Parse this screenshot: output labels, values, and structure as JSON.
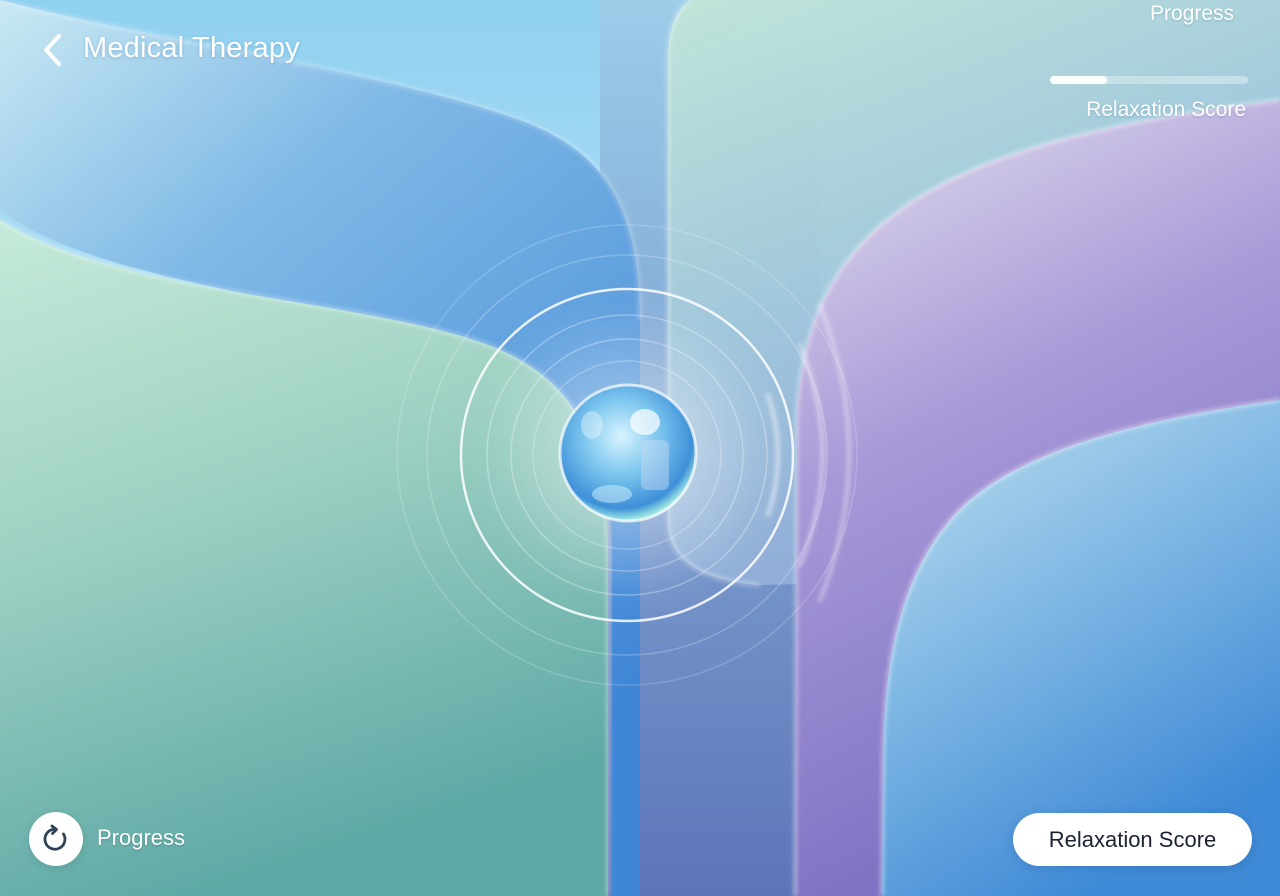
{
  "header": {
    "title": "Medical Therapy",
    "back_icon": "chevron-left-icon"
  },
  "progress_panel": {
    "label": "Progress",
    "fill_fraction": 0.29,
    "score_label": "Relaxation Score"
  },
  "footer": {
    "restart_icon": "rotate-clockwise-icon",
    "progress_label": "Progress",
    "score_button_label": "Relaxation Score"
  },
  "colors": {
    "teal": "#6fbfb0",
    "sky_blue": "#8fd0f0",
    "lavender": "#a896d6",
    "deep_blue": "#4a8fd8",
    "white": "#ffffff"
  }
}
